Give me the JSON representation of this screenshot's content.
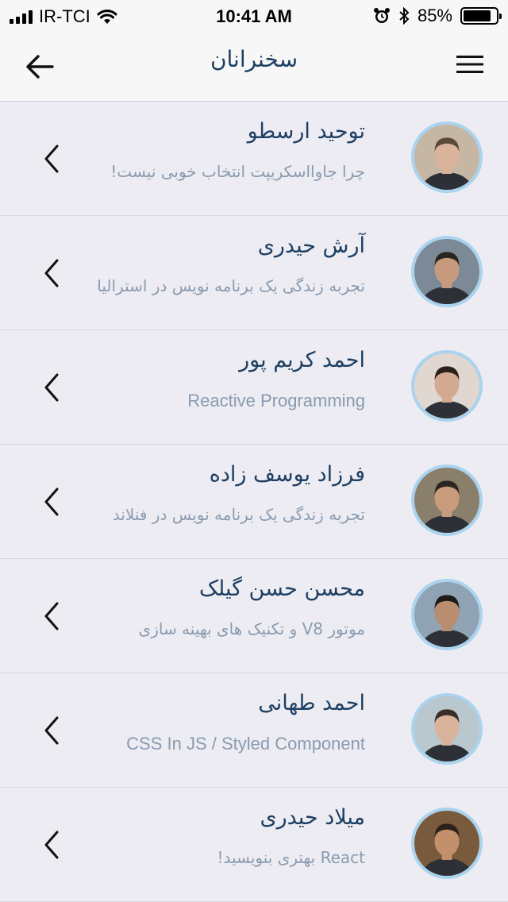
{
  "status_bar": {
    "carrier": "IR-TCI",
    "time": "10:41 AM",
    "battery_percent": "85%",
    "battery_level": 0.85
  },
  "nav": {
    "title": "سخنرانان",
    "back_icon": "arrow-left-icon",
    "menu_icon": "hamburger-menu-icon"
  },
  "speakers": [
    {
      "name": "توحید ارسطو",
      "subtitle": "چرا جاوااسکریپت انتخاب خوبی نیست!",
      "ltr": false,
      "skin": "#d9b49a",
      "hair": "#5a4a3c",
      "bg": "#c6b7a5"
    },
    {
      "name": "آرش حیدری",
      "subtitle": "تجربه زندگی یک برنامه نویس در استرالیا",
      "ltr": false,
      "skin": "#c79a7e",
      "hair": "#2b2520",
      "bg": "#7b8a96"
    },
    {
      "name": "احمد کریم پور",
      "subtitle": "Reactive Programming",
      "ltr": true,
      "skin": "#d3a990",
      "hair": "#2a211c",
      "bg": "#e0d8d0"
    },
    {
      "name": "فرزاد یوسف زاده",
      "subtitle": "تجربه زندگی یک برنامه نویس در فنلاند",
      "ltr": false,
      "skin": "#c89b7c",
      "hair": "#2c2520",
      "bg": "#8a7f6a"
    },
    {
      "name": "محسن حسن گیلک",
      "subtitle": "موتور V8 و تکنیک های بهینه سازی",
      "ltr": false,
      "skin": "#b98d70",
      "hair": "#1e1a17",
      "bg": "#8fa3b5"
    },
    {
      "name": "احمد طهانی",
      "subtitle": "CSS In JS / Styled Component",
      "ltr": true,
      "skin": "#d9b49c",
      "hair": "#3a2e26",
      "bg": "#b9c7cf"
    },
    {
      "name": "میلاد حیدری",
      "subtitle": "React بهتری بنویسید!",
      "ltr": false,
      "skin": "#c3906c",
      "hair": "#2d221a",
      "bg": "#7a5a3c"
    }
  ]
}
